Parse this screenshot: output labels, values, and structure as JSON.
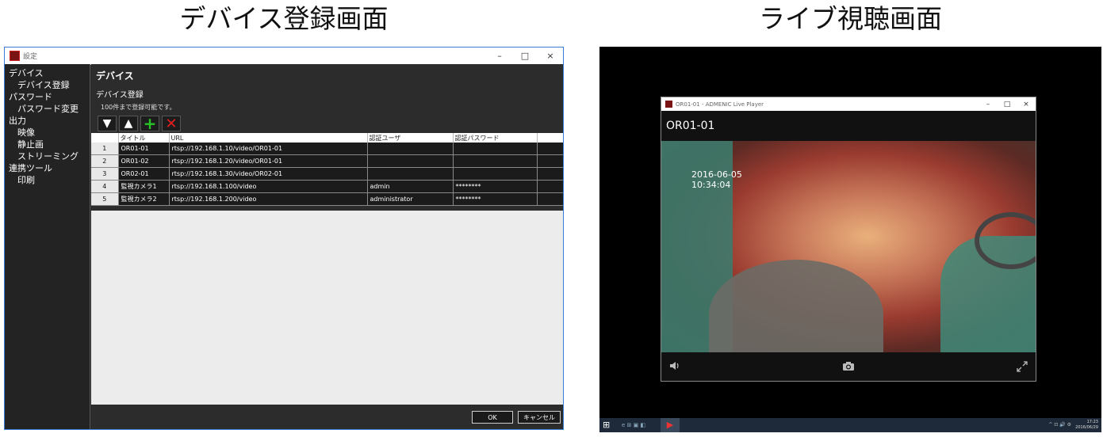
{
  "captions": {
    "left": "デバイス登録画面",
    "right": "ライブ視聴画面"
  },
  "settings_window": {
    "title": "設定",
    "controls": {
      "minimize": "–",
      "maximize": "□",
      "close": "×"
    },
    "sidebar": [
      {
        "label": "デバイス",
        "level": 0
      },
      {
        "label": "デバイス登録",
        "level": 1
      },
      {
        "label": "パスワード",
        "level": 0
      },
      {
        "label": "パスワード変更",
        "level": 1
      },
      {
        "label": "出力",
        "level": 0
      },
      {
        "label": "映像",
        "level": 1
      },
      {
        "label": "静止画",
        "level": 1
      },
      {
        "label": "ストリーミング",
        "level": 1
      },
      {
        "label": "連携ツール",
        "level": 0
      },
      {
        "label": "印刷",
        "level": 1
      }
    ],
    "heading": "デバイス",
    "subheading": "デバイス登録",
    "note": "100件まで登録可能です。",
    "toolbar": {
      "down": "▼",
      "up": "▲",
      "add": "+",
      "delete": "✕"
    },
    "table": {
      "headers": [
        "",
        "タイトル",
        "URL",
        "認証ユーザ",
        "認証パスワード",
        ""
      ],
      "rows": [
        [
          "1",
          "OR01-01",
          "rtsp://192.168.1.10/video/OR01-01",
          "",
          ""
        ],
        [
          "2",
          "OR01-02",
          "rtsp://192.168.1.20/video/OR01-01",
          "",
          ""
        ],
        [
          "3",
          "OR02-01",
          "rtsp://192.168.1.30/video/OR02-01",
          "",
          ""
        ],
        [
          "4",
          "監視カメラ1",
          "rtsp://192.168.1.100/video",
          "admin",
          "********"
        ],
        [
          "5",
          "監視カメラ2",
          "rtsp://192.168.1.200/video",
          "administrator",
          "********"
        ]
      ]
    },
    "ok": "OK",
    "cancel": "キャンセル"
  },
  "player_window": {
    "title": "OR01-01 - ADMENIC Live Player",
    "controls": {
      "minimize": "–",
      "maximize": "□",
      "close": "×"
    },
    "device_name": "OR01-01",
    "timestamp": "2016-06-05\n10:34:04",
    "icons": {
      "volume": "volume-icon",
      "snapshot": "camera-icon",
      "fullscreen": "expand-icon"
    }
  },
  "taskbar": {
    "apps": "e ⊞ ▣ ◧",
    "tray": "^ ⊡ 🔊 ⚙",
    "time": "17:23",
    "date": "2016/06/29"
  },
  "colors": {
    "accent_border": "#3a7bd5",
    "add_green": "#27c427",
    "delete_red": "#e41f1f"
  }
}
